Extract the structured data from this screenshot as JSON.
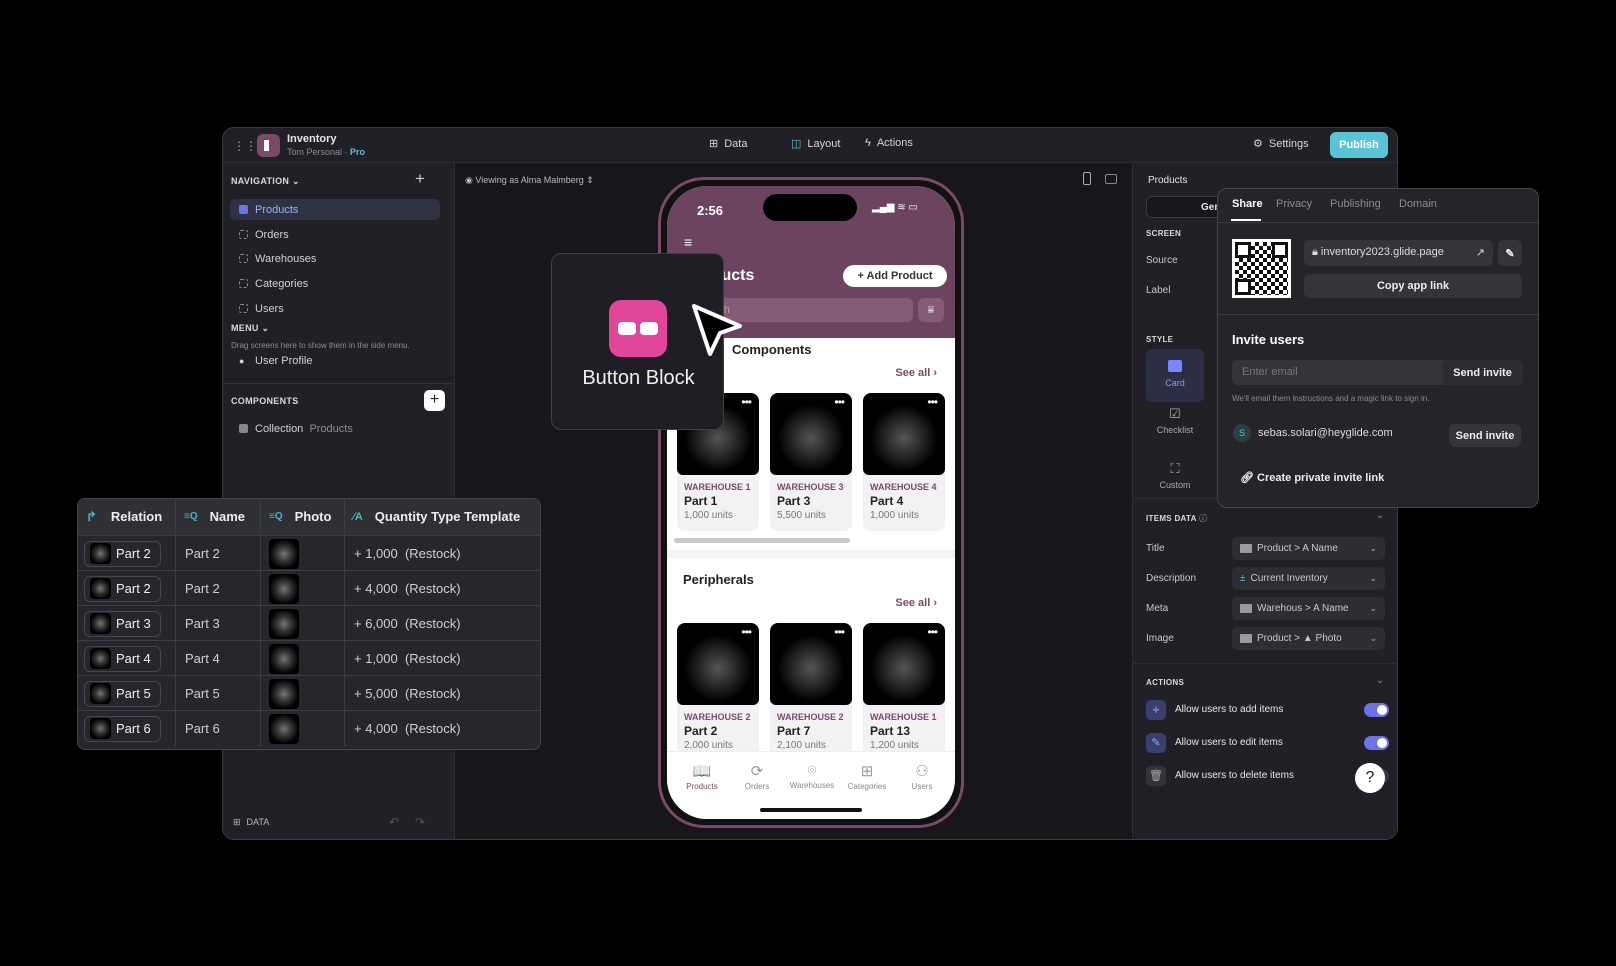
{
  "app": {
    "title": "Inventory",
    "subtitle": "Tom Personal ·",
    "plan": "Pro"
  },
  "topbar": {
    "tabs": [
      {
        "label": "Data",
        "icon": "table-icon"
      },
      {
        "label": "Layout",
        "icon": "layout-icon"
      },
      {
        "label": "Actions",
        "icon": "lightning-icon"
      }
    ],
    "settings": "Settings",
    "publish": "Publish"
  },
  "sidebar": {
    "navigation_label": "NAVIGATION",
    "items": [
      "Products",
      "Orders",
      "Warehouses",
      "Categories",
      "Users"
    ],
    "menu_label": "MENU",
    "menu_hint": "Drag screens here to show them in the side menu.",
    "menu_items": [
      "User Profile"
    ],
    "components_label": "COMPONENTS",
    "components": [
      {
        "label": "Collection",
        "source": "Products"
      }
    ],
    "footer": "DATA"
  },
  "canvas": {
    "viewing_as": "Viewing as Alma Malmberg"
  },
  "phone": {
    "time": "2:56",
    "title": "Products",
    "add_button": "+ Add Product",
    "search_placeholder": "Search",
    "sections": [
      {
        "title": "Components",
        "see_all": "See all",
        "cards": [
          {
            "warehouse": "WAREHOUSE 1",
            "part": "Part 1",
            "units": "1,000 units"
          },
          {
            "warehouse": "WAREHOUSE 3",
            "part": "Part 3",
            "units": "5,500 units"
          },
          {
            "warehouse": "WAREHOUSE 4",
            "part": "Part 4",
            "units": "1,000 units"
          }
        ]
      },
      {
        "title": "Peripherals",
        "see_all": "See all",
        "cards": [
          {
            "warehouse": "WAREHOUSE 2",
            "part": "Part 2",
            "units": "2,000 units"
          },
          {
            "warehouse": "WAREHOUSE 2",
            "part": "Part 7",
            "units": "2,100 units"
          },
          {
            "warehouse": "WAREHOUSE 1",
            "part": "Part 13",
            "units": "1,200 units"
          }
        ]
      }
    ],
    "tabs": [
      "Products",
      "Orders",
      "Warehouses",
      "Categories",
      "Users"
    ]
  },
  "button_block": {
    "label": "Button Block",
    "color": "#e0479b"
  },
  "table": {
    "headers": [
      "Relation",
      "Name",
      "Photo",
      "Quantity Type Template"
    ],
    "rows": [
      [
        "Part 2",
        "Part 2",
        "+ 1,000  (Restock)"
      ],
      [
        "Part 2",
        "Part 2",
        "+ 4,000  (Restock)"
      ],
      [
        "Part 3",
        "Part 3",
        "+ 6,000  (Restock)"
      ],
      [
        "Part 4",
        "Part 4",
        "+ 1,000  (Restock)"
      ],
      [
        "Part 5",
        "Part 5",
        "+ 5,000  (Restock)"
      ],
      [
        "Part 6",
        "Part 6",
        "+ 4,000  (Restock)"
      ]
    ]
  },
  "rpanel": {
    "title": "Products",
    "segment": "General",
    "screen_label": "SCREEN",
    "source": "Source",
    "label": "Label",
    "style_label": "STYLE",
    "styles": [
      "Card",
      "Checklist",
      "Custom"
    ],
    "items_data_label": "ITEMS DATA",
    "fields": [
      {
        "label": "Title",
        "value": "Product >  A  Name"
      },
      {
        "label": "Description",
        "value": "Current Inventory"
      },
      {
        "label": "Meta",
        "value": "Warehous >  A  Name"
      },
      {
        "label": "Image",
        "value": "Product >  ▲  Photo"
      }
    ],
    "actions_label": "ACTIONS",
    "actions": [
      {
        "label": "Allow users to add items",
        "on": true
      },
      {
        "label": "Allow users to edit items",
        "on": true
      },
      {
        "label": "Allow users to delete items",
        "on": false
      }
    ],
    "help": "?"
  },
  "share": {
    "tabs": [
      "Share",
      "Privacy",
      "Publishing",
      "Domain"
    ],
    "url": "inventory2023.glide.page",
    "copy": "Copy app link",
    "invite_title": "Invite users",
    "email_placeholder": "Enter email",
    "send": "Send invite",
    "hint": "We'll email them instructions and a magic link to sign in.",
    "invitee": "sebas.solari@heyglide.com",
    "invitee_initial": "S",
    "private_link": "Create private invite link"
  },
  "colors": {
    "accent": "#5bc3d6",
    "toggle": "#6a74e8",
    "phone_header": "#6c4460"
  }
}
